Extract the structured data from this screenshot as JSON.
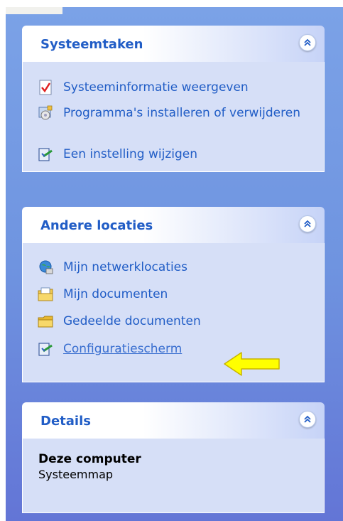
{
  "panels": [
    {
      "title": "Systeemtaken",
      "items": [
        {
          "label": "Systeeminformatie weergeven",
          "icon": "system-info-icon"
        },
        {
          "label": "Programma's installeren of verwijderen",
          "icon": "add-remove-programs-icon"
        },
        {
          "label": "Een instelling wijzigen",
          "icon": "change-setting-icon"
        }
      ]
    },
    {
      "title": "Andere locaties",
      "items": [
        {
          "label": "Mijn netwerklocaties",
          "icon": "network-places-icon"
        },
        {
          "label": "Mijn documenten",
          "icon": "my-documents-icon"
        },
        {
          "label": "Gedeelde documenten",
          "icon": "shared-documents-folder-icon"
        },
        {
          "label": "Configuratiescherm",
          "icon": "control-panel-icon"
        }
      ]
    },
    {
      "title": "Details",
      "detail_name": "Deze computer",
      "detail_type": "Systeemmap"
    }
  ],
  "colors": {
    "title_blue": "#215dc6",
    "sidebar_top": "#7ba2e7",
    "sidebar_bottom": "#6375d6",
    "panel_body": "#d6dff7",
    "arrow_yellow": "#ffff00"
  }
}
